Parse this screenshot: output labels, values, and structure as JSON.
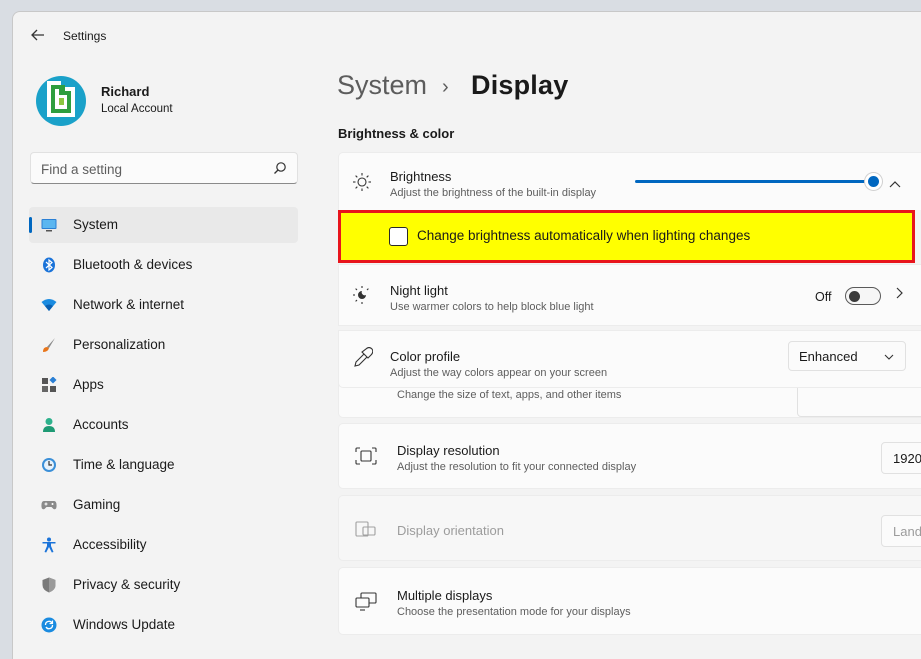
{
  "window": {
    "title": "Settings"
  },
  "user": {
    "name": "Richard",
    "account_type": "Local Account"
  },
  "search": {
    "placeholder": "Find a setting"
  },
  "sidebar": {
    "items": [
      {
        "label": "System",
        "icon": "monitor-icon",
        "selected": true
      },
      {
        "label": "Bluetooth & devices",
        "icon": "bluetooth-icon"
      },
      {
        "label": "Network & internet",
        "icon": "wifi-icon"
      },
      {
        "label": "Personalization",
        "icon": "brush-icon"
      },
      {
        "label": "Apps",
        "icon": "apps-icon"
      },
      {
        "label": "Accounts",
        "icon": "person-icon"
      },
      {
        "label": "Time & language",
        "icon": "clock-globe-icon"
      },
      {
        "label": "Gaming",
        "icon": "gamepad-icon"
      },
      {
        "label": "Accessibility",
        "icon": "accessibility-icon"
      },
      {
        "label": "Privacy & security",
        "icon": "shield-icon"
      },
      {
        "label": "Windows Update",
        "icon": "update-icon"
      }
    ]
  },
  "breadcrumb": {
    "parent": "System",
    "separator": "›",
    "current": "Display"
  },
  "section": {
    "title": "Brightness & color"
  },
  "brightness": {
    "title": "Brightness",
    "subtitle": "Adjust the brightness of the built-in display",
    "value_percent": 100
  },
  "auto_brightness": {
    "label": "Change brightness automatically when lighting changes",
    "checked": false
  },
  "night_light": {
    "title": "Night light",
    "subtitle": "Use warmer colors to help block blue light",
    "state": "Off"
  },
  "color_profile": {
    "title": "Color profile",
    "subtitle": "Adjust the way colors appear on your screen",
    "value": "Enhanced"
  },
  "scale": {
    "subtitle_partial": "Change the size of text, apps, and other items"
  },
  "resolution": {
    "title": "Display resolution",
    "subtitle": "Adjust the resolution to fit your connected display",
    "value": "1920"
  },
  "orientation": {
    "title": "Display orientation",
    "value": "Land"
  },
  "multiple": {
    "title": "Multiple displays",
    "subtitle": "Choose the presentation mode for your displays"
  },
  "colors": {
    "accent": "#0067c0",
    "highlight": "#ffff00",
    "highlight_border": "#e8141c"
  }
}
